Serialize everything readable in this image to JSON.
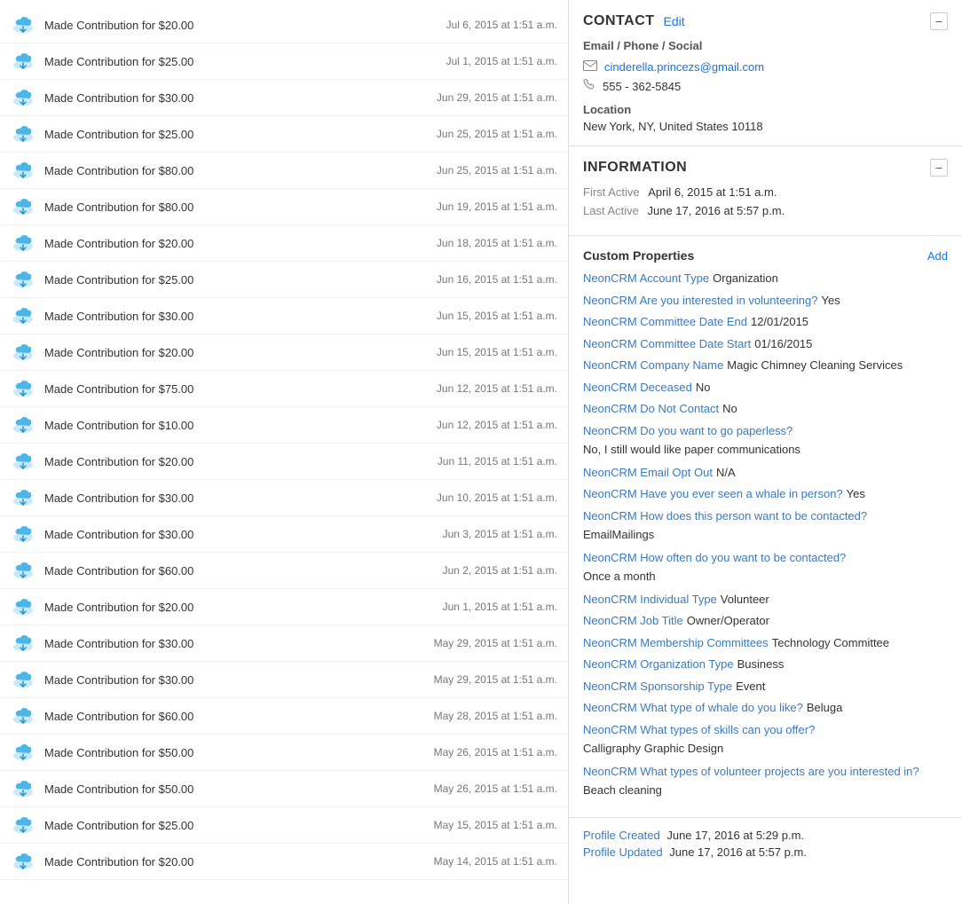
{
  "activities": [
    {
      "text": "Made Contribution for $20.00",
      "date": "Jul 6, 2015 at 1:51 a.m."
    },
    {
      "text": "Made Contribution for $25.00",
      "date": "Jul 1, 2015 at 1:51 a.m."
    },
    {
      "text": "Made Contribution for $30.00",
      "date": "Jun 29, 2015 at 1:51 a.m."
    },
    {
      "text": "Made Contribution for $25.00",
      "date": "Jun 25, 2015 at 1:51 a.m."
    },
    {
      "text": "Made Contribution for $80.00",
      "date": "Jun 25, 2015 at 1:51 a.m."
    },
    {
      "text": "Made Contribution for $80.00",
      "date": "Jun 19, 2015 at 1:51 a.m."
    },
    {
      "text": "Made Contribution for $20.00",
      "date": "Jun 18, 2015 at 1:51 a.m."
    },
    {
      "text": "Made Contribution for $25.00",
      "date": "Jun 16, 2015 at 1:51 a.m."
    },
    {
      "text": "Made Contribution for $30.00",
      "date": "Jun 15, 2015 at 1:51 a.m."
    },
    {
      "text": "Made Contribution for $20.00",
      "date": "Jun 15, 2015 at 1:51 a.m."
    },
    {
      "text": "Made Contribution for $75.00",
      "date": "Jun 12, 2015 at 1:51 a.m."
    },
    {
      "text": "Made Contribution for $10.00",
      "date": "Jun 12, 2015 at 1:51 a.m."
    },
    {
      "text": "Made Contribution for $20.00",
      "date": "Jun 11, 2015 at 1:51 a.m."
    },
    {
      "text": "Made Contribution for $30.00",
      "date": "Jun 10, 2015 at 1:51 a.m."
    },
    {
      "text": "Made Contribution for $30.00",
      "date": "Jun 3, 2015 at 1:51 a.m."
    },
    {
      "text": "Made Contribution for $60.00",
      "date": "Jun 2, 2015 at 1:51 a.m."
    },
    {
      "text": "Made Contribution for $20.00",
      "date": "Jun 1, 2015 at 1:51 a.m."
    },
    {
      "text": "Made Contribution for $30.00",
      "date": "May 29, 2015 at 1:51 a.m."
    },
    {
      "text": "Made Contribution for $30.00",
      "date": "May 29, 2015 at 1:51 a.m."
    },
    {
      "text": "Made Contribution for $60.00",
      "date": "May 28, 2015 at 1:51 a.m."
    },
    {
      "text": "Made Contribution for $50.00",
      "date": "May 26, 2015 at 1:51 a.m."
    },
    {
      "text": "Made Contribution for $50.00",
      "date": "May 26, 2015 at 1:51 a.m."
    },
    {
      "text": "Made Contribution for $25.00",
      "date": "May 15, 2015 at 1:51 a.m."
    },
    {
      "text": "Made Contribution for $20.00",
      "date": "May 14, 2015 at 1:51 a.m."
    }
  ],
  "contact": {
    "section_title": "CONTACT",
    "edit_label": "Edit",
    "subtitle": "Email / Phone / Social",
    "email": "cinderella.princezs@gmail.com",
    "phone": "555 - 362-5845",
    "location_label": "Location",
    "location_value": "New York, NY, United States 10118"
  },
  "information": {
    "section_title": "INFORMATION",
    "first_active_label": "First Active",
    "first_active_value": "April 6, 2015 at 1:51 a.m.",
    "last_active_label": "Last Active",
    "last_active_value": "June 17, 2016 at 5:57 p.m."
  },
  "custom_properties": {
    "title": "Custom Properties",
    "add_label": "Add",
    "properties": [
      {
        "label": "NeonCRM Account Type",
        "value": "Organization"
      },
      {
        "label": "NeonCRM Are you interested in volunteering?",
        "value": "Yes"
      },
      {
        "label": "NeonCRM Committee Date End",
        "value": "12/01/2015"
      },
      {
        "label": "NeonCRM Committee Date Start",
        "value": "01/16/2015"
      },
      {
        "label": "NeonCRM Company Name",
        "value": "Magic Chimney Cleaning Services"
      },
      {
        "label": "NeonCRM Deceased",
        "value": "No"
      },
      {
        "label": "NeonCRM Do Not Contact",
        "value": "No"
      },
      {
        "label": "NeonCRM Do you want to go paperless?",
        "value": "No, I still would like paper communications",
        "block": true
      },
      {
        "label": "NeonCRM Email Opt Out",
        "value": "N/A"
      },
      {
        "label": "NeonCRM Have you ever seen a whale in person?",
        "value": "Yes"
      },
      {
        "label": "NeonCRM How does this person want to be contacted?",
        "value": "EmailMailings",
        "block": true
      },
      {
        "label": "NeonCRM How often do you want to be contacted?",
        "value": "Once a month",
        "block": true
      },
      {
        "label": "NeonCRM Individual Type",
        "value": "Volunteer"
      },
      {
        "label": "NeonCRM Job Title",
        "value": "Owner/Operator"
      },
      {
        "label": "NeonCRM Membership Committees",
        "value": "Technology Committee"
      },
      {
        "label": "NeonCRM Organization Type",
        "value": "Business"
      },
      {
        "label": "NeonCRM Sponsorship Type",
        "value": "Event"
      },
      {
        "label": "NeonCRM What type of whale do you like?",
        "value": "Beluga"
      },
      {
        "label": "NeonCRM What types of skills can you offer?",
        "value": "Calligraphy Graphic Design",
        "block": true
      },
      {
        "label": "NeonCRM What types of volunteer projects are you interested in?",
        "value": "Beach cleaning",
        "block": true
      }
    ]
  },
  "profile": {
    "created_label": "Profile Created",
    "created_value": "June 17, 2016 at 5:29 p.m.",
    "updated_label": "Profile Updated",
    "updated_value": "June 17, 2016 at 5:57 p.m."
  }
}
